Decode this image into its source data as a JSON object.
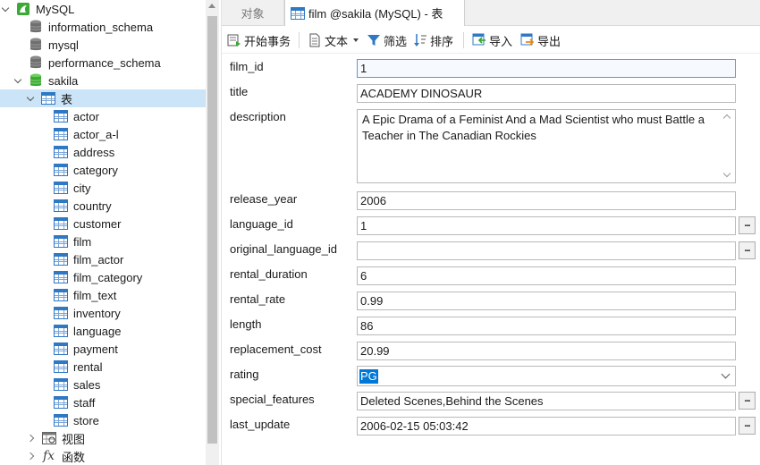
{
  "colors": {
    "selection": "#cce4f7",
    "accent": "#0078d7",
    "table_icon": "#2f78c4",
    "db_green": "#3aa935"
  },
  "tree": {
    "connection": {
      "label": "MySQL",
      "icon": "mysql-connection-icon"
    },
    "databases": [
      "information_schema",
      "mysql",
      "performance_schema"
    ],
    "active_db": {
      "label": "sakila",
      "icon": "database-icon"
    },
    "tables_node": {
      "label": "表",
      "icon": "table-folder-icon"
    },
    "tables": [
      "actor",
      "actor_a-l",
      "address",
      "category",
      "city",
      "country",
      "customer",
      "film",
      "film_actor",
      "film_category",
      "film_text",
      "inventory",
      "language",
      "payment",
      "rental",
      "sales",
      "staff",
      "store"
    ],
    "views_node": {
      "label": "视图",
      "icon": "view-icon"
    },
    "functions_node": {
      "label": "函数",
      "icon": "function-icon"
    }
  },
  "tabs": {
    "objects": "对象",
    "active": "film @sakila (MySQL) - 表"
  },
  "toolbar": {
    "begin_transaction": "开始事务",
    "text": "文本",
    "filter": "筛选",
    "sort": "排序",
    "import": "导入",
    "export": "导出"
  },
  "form": {
    "fields": {
      "film_id": {
        "label": "film_id",
        "value": "1"
      },
      "title": {
        "label": "title",
        "value": "ACADEMY DINOSAUR"
      },
      "description": {
        "label": "description",
        "value": "A Epic Drama of a Feminist And a Mad Scientist who must Battle a Teacher in The Canadian Rockies"
      },
      "release_year": {
        "label": "release_year",
        "value": "2006"
      },
      "language_id": {
        "label": "language_id",
        "value": "1"
      },
      "original_language_id": {
        "label": "original_language_id",
        "value": ""
      },
      "rental_duration": {
        "label": "rental_duration",
        "value": "6"
      },
      "rental_rate": {
        "label": "rental_rate",
        "value": "0.99"
      },
      "length": {
        "label": "length",
        "value": "86"
      },
      "replacement_cost": {
        "label": "replacement_cost",
        "value": "20.99"
      },
      "rating": {
        "label": "rating",
        "value": "PG"
      },
      "special_features": {
        "label": "special_features",
        "value": "Deleted Scenes,Behind the Scenes"
      },
      "last_update": {
        "label": "last_update",
        "value": "2006-02-15 05:03:42"
      }
    },
    "ellipsis_label": "..."
  }
}
